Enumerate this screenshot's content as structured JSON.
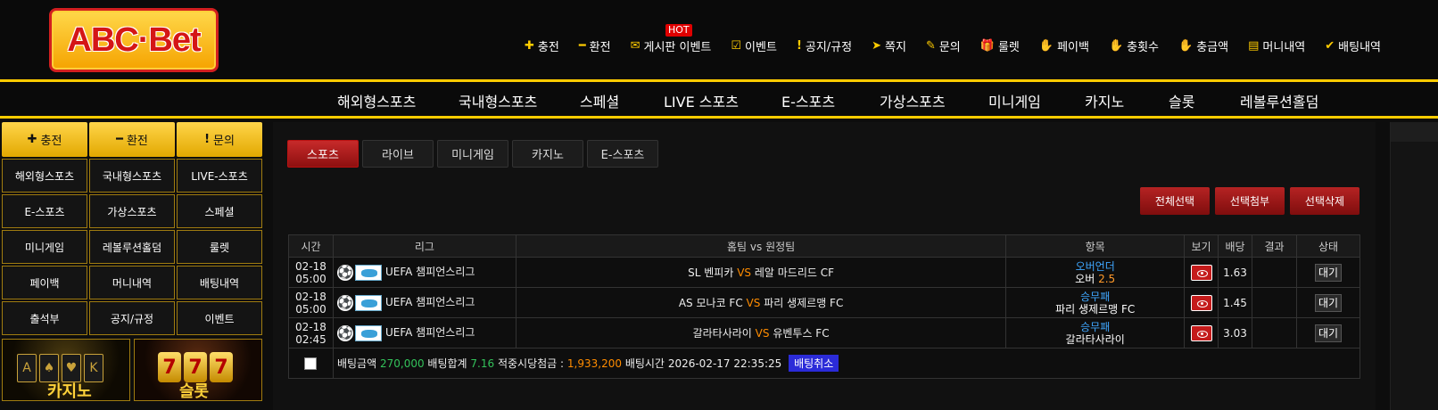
{
  "logo": {
    "text": "ABC·Bet"
  },
  "hot_badge": "HOT",
  "top_nav": [
    {
      "icon": "plus-icon",
      "glyph": "✚",
      "label": "충전"
    },
    {
      "icon": "minus-icon",
      "glyph": "━",
      "label": "환전"
    },
    {
      "icon": "board-icon",
      "glyph": "✉",
      "label": "게시판 이벤트"
    },
    {
      "icon": "calendar-check-icon",
      "glyph": "☑",
      "label": "이벤트"
    },
    {
      "icon": "alert-icon",
      "glyph": "!",
      "label": "공지/규정"
    },
    {
      "icon": "send-icon",
      "glyph": "➤",
      "label": "쪽지"
    },
    {
      "icon": "edit-icon",
      "glyph": "✎",
      "label": "문의"
    },
    {
      "icon": "gift-icon",
      "glyph": "🎁",
      "label": "룰렛"
    },
    {
      "icon": "hand-coin-icon",
      "glyph": "✋",
      "label": "페이백"
    },
    {
      "icon": "hand-coin-icon",
      "glyph": "✋",
      "label": "충횟수"
    },
    {
      "icon": "hand-coin-icon",
      "glyph": "✋",
      "label": "충금액"
    },
    {
      "icon": "receipt-icon",
      "glyph": "▤",
      "label": "머니내역"
    },
    {
      "icon": "check-icon",
      "glyph": "✔",
      "label": "배팅내역"
    }
  ],
  "main_nav": [
    "해외형스포츠",
    "국내형스포츠",
    "스페셜",
    "LIVE 스포츠",
    "E-스포츠",
    "가상스포츠",
    "미니게임",
    "카지노",
    "슬롯",
    "레볼루션홀덤"
  ],
  "sidebar": {
    "quick": [
      {
        "icon": "plus-icon",
        "glyph": "✚",
        "label": "충전"
      },
      {
        "icon": "minus-icon",
        "glyph": "━",
        "label": "환전"
      },
      {
        "icon": "alert-icon",
        "glyph": "!",
        "label": "문의"
      }
    ],
    "grid": [
      "해외형스포츠",
      "국내형스포츠",
      "LIVE-스포츠",
      "E-스포츠",
      "가상스포츠",
      "스페셜",
      "미니게임",
      "레볼루션홀덤",
      "룰렛",
      "페이백",
      "머니내역",
      "배팅내역",
      "출석부",
      "공지/규정",
      "이벤트"
    ],
    "banners": [
      {
        "name": "casino",
        "text": "카지노"
      },
      {
        "name": "slot",
        "text": "슬롯"
      }
    ]
  },
  "tabs": [
    {
      "label": "스포츠",
      "active": true
    },
    {
      "label": "라이브",
      "active": false
    },
    {
      "label": "미니게임",
      "active": false
    },
    {
      "label": "카지노",
      "active": false
    },
    {
      "label": "E-스포츠",
      "active": false
    }
  ],
  "actions": [
    "전체선택",
    "선택첨부",
    "선택삭제"
  ],
  "table": {
    "headers": [
      "시간",
      "리그",
      "홈팀 vs 원정팀",
      "항목",
      "보기",
      "배당",
      "결과",
      "상태"
    ],
    "rows": [
      {
        "date": "02-18",
        "time": "05:00",
        "league": "UEFA 챔피언스리그",
        "home": "SL 벤피카",
        "vs": "VS",
        "away": "레알 마드리드 CF",
        "pick_type": "오버언더",
        "pick": "오버",
        "pick_num": "2.5",
        "odds": "1.63",
        "result": "",
        "status": "대기"
      },
      {
        "date": "02-18",
        "time": "05:00",
        "league": "UEFA 챔피언스리그",
        "home": "AS 모나코 FC",
        "vs": "VS",
        "away": "파리 생제르맹 FC",
        "pick_type": "승무패",
        "pick": "파리 생제르맹 FC",
        "pick_num": "",
        "odds": "1.45",
        "result": "",
        "status": "대기"
      },
      {
        "date": "02-18",
        "time": "02:45",
        "league": "UEFA 챔피언스리그",
        "home": "갈라타사라이",
        "vs": "VS",
        "away": "유벤투스 FC",
        "pick_type": "승무패",
        "pick": "갈라타사라이",
        "pick_num": "",
        "odds": "3.03",
        "result": "",
        "status": "대기"
      }
    ],
    "summary": {
      "amount_label": "배팅금액",
      "amount": "270,000",
      "total_odds_label": "배팅합계",
      "total_odds": "7.16",
      "payout_label": "적중시당첨금 :",
      "payout": "1,933,200",
      "time_label": "배팅시간",
      "time": "2026-02-17 22:35:25",
      "cancel": "배팅취소"
    }
  }
}
